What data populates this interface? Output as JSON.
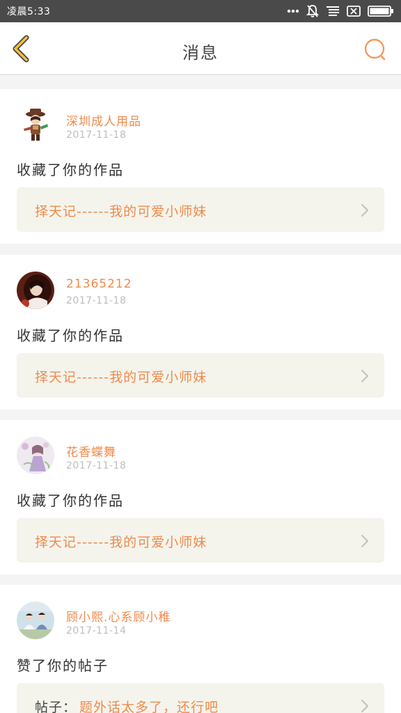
{
  "status_bar": {
    "time": "凌晨5:33",
    "icons": [
      "more-dots-icon",
      "bell-off-icon",
      "notification-list-icon",
      "sim-x-icon",
      "battery-icon"
    ]
  },
  "nav": {
    "title": "消息",
    "back_icon": "chevron-left-icon",
    "search_icon": "search-icon",
    "accent_color": "#f0c040",
    "search_color": "#f29a5c"
  },
  "messages": [
    {
      "user": "深圳成人用品",
      "date": "2017-11-18",
      "action": "收藏了你的作品",
      "prefix": "",
      "target": "择天记------我的可爱小师妹"
    },
    {
      "user": "21365212",
      "date": "2017-11-18",
      "action": "收藏了你的作品",
      "prefix": "",
      "target": "择天记------我的可爱小师妹"
    },
    {
      "user": "花香蝶舞",
      "date": "2017-11-18",
      "action": "收藏了你的作品",
      "prefix": "",
      "target": "择天记------我的可爱小师妹"
    },
    {
      "user": "顾小熙.心系顾小稚",
      "date": "2017-11-14",
      "action": "赞了你的帖子",
      "prefix": "帖子：",
      "target": "题外话太多了，还行吧"
    }
  ],
  "colors": {
    "accent_orange": "#f08a4b",
    "date_gray": "#bdbdbd",
    "box_bg": "#f4f4ec",
    "status_bar_bg": "#4a4a4a"
  }
}
